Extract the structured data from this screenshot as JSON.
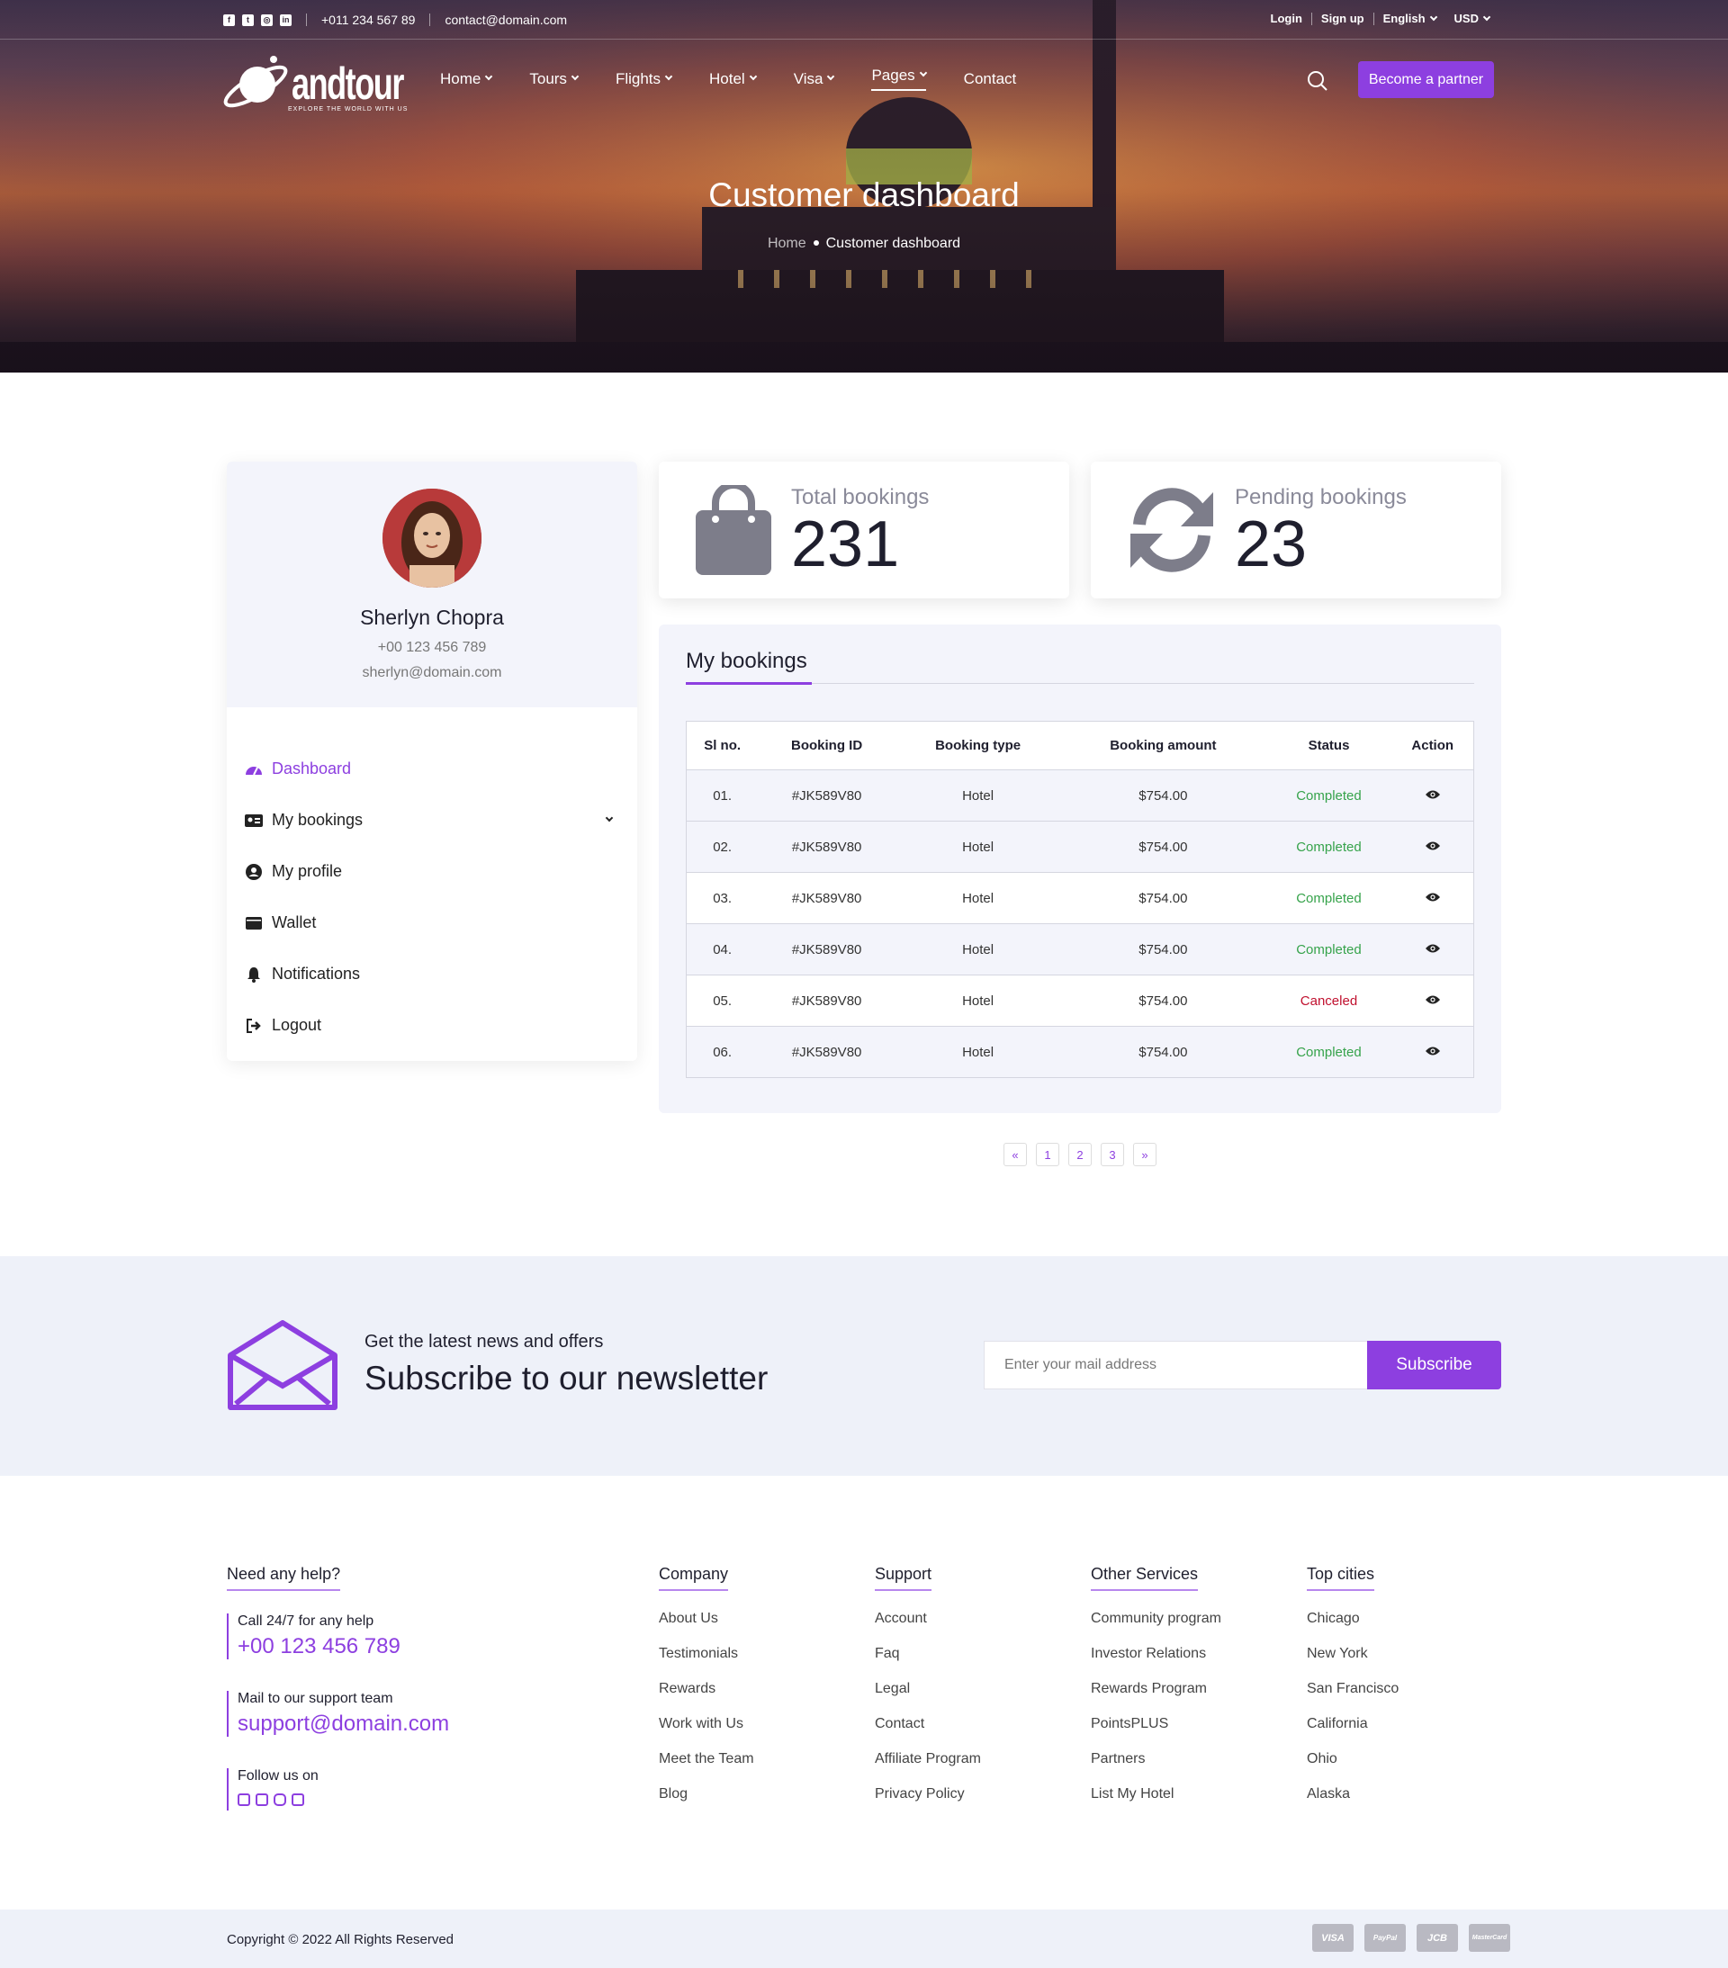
{
  "topbar": {
    "phone": "+011 234 567 89",
    "email": "contact@domain.com",
    "login": "Login",
    "signup": "Sign up",
    "language": "English",
    "currency": "USD",
    "social_icons": [
      "facebook-icon",
      "twitter-icon",
      "instagram-icon",
      "linkedin-icon"
    ]
  },
  "nav": {
    "logo_text": "andtour",
    "logo_tagline": "EXPLORE THE WORLD WITH US",
    "items": [
      {
        "label": "Home",
        "dropdown": true
      },
      {
        "label": "Tours",
        "dropdown": true
      },
      {
        "label": "Flights",
        "dropdown": true
      },
      {
        "label": "Hotel",
        "dropdown": true
      },
      {
        "label": "Visa",
        "dropdown": true
      },
      {
        "label": "Pages",
        "dropdown": true,
        "active": true
      },
      {
        "label": "Contact",
        "dropdown": false
      }
    ],
    "partner_button": "Become a partner"
  },
  "hero": {
    "title": "Customer dashboard",
    "breadcrumb_home": "Home",
    "breadcrumb_current": "Customer dashboard"
  },
  "profile": {
    "name": "Sherlyn Chopra",
    "phone": "+00 123 456 789",
    "email": "sherlyn@domain.com"
  },
  "sidebar": {
    "items": [
      {
        "label": "Dashboard",
        "icon": "dashboard-icon",
        "active": true
      },
      {
        "label": "My bookings",
        "icon": "id-card-icon"
      },
      {
        "label": "My profile",
        "icon": "user-circle-icon"
      },
      {
        "label": "Wallet",
        "icon": "wallet-icon"
      },
      {
        "label": "Notifications",
        "icon": "bell-icon"
      },
      {
        "label": "Logout",
        "icon": "logout-icon"
      }
    ]
  },
  "stats": {
    "total_label": "Total bookings",
    "total_value": "231",
    "pending_label": "Pending bookings",
    "pending_value": "23"
  },
  "bookings": {
    "title": "My bookings",
    "columns": [
      "Sl no.",
      "Booking ID",
      "Booking type",
      "Booking amount",
      "Status",
      "Action"
    ],
    "rows": [
      {
        "no": "01.",
        "id": "#JK589V80",
        "type": "Hotel",
        "amount": "$754.00",
        "status": "Completed"
      },
      {
        "no": "02.",
        "id": "#JK589V80",
        "type": "Hotel",
        "amount": "$754.00",
        "status": "Completed"
      },
      {
        "no": "03.",
        "id": "#JK589V80",
        "type": "Hotel",
        "amount": "$754.00",
        "status": "Completed"
      },
      {
        "no": "04.",
        "id": "#JK589V80",
        "type": "Hotel",
        "amount": "$754.00",
        "status": "Completed"
      },
      {
        "no": "05.",
        "id": "#JK589V80",
        "type": "Hotel",
        "amount": "$754.00",
        "status": "Canceled"
      },
      {
        "no": "06.",
        "id": "#JK589V80",
        "type": "Hotel",
        "amount": "$754.00",
        "status": "Completed"
      }
    ],
    "status_colors": {
      "Completed": "#36a34b",
      "Canceled": "#c0102e"
    }
  },
  "pagination": {
    "prev": "«",
    "pages": [
      "1",
      "2",
      "3"
    ],
    "next": "»"
  },
  "newsletter": {
    "small": "Get the latest news and offers",
    "big": "Subscribe to our newsletter",
    "placeholder": "Enter your mail address",
    "button": "Subscribe"
  },
  "footer": {
    "help": {
      "title": "Need any help?",
      "call_label": "Call 24/7 for any help",
      "call_value": "+00 123 456 789",
      "mail_label": "Mail to our support team",
      "mail_value": "support@domain.com",
      "follow_label": "Follow us on"
    },
    "columns": [
      {
        "title": "Company",
        "links": [
          "About Us",
          "Testimonials",
          "Rewards",
          "Work with Us",
          "Meet the Team",
          "Blog"
        ]
      },
      {
        "title": "Support",
        "links": [
          "Account",
          "Faq",
          "Legal",
          "Contact",
          "Affiliate Program",
          "Privacy Policy"
        ]
      },
      {
        "title": "Other Services",
        "links": [
          "Community program",
          "Investor Relations",
          "Rewards Program",
          "PointsPLUS",
          "Partners",
          "List My Hotel"
        ]
      },
      {
        "title": "Top cities",
        "links": [
          "Chicago",
          "New York",
          "San Francisco",
          "California",
          "Ohio",
          "Alaska"
        ]
      }
    ],
    "copyright": "Copyright © 2022 All Rights Reserved",
    "payment_cards": [
      "VISA",
      "PayPal",
      "JCB",
      "MasterCard"
    ]
  },
  "colors": {
    "accent": "#8d3fe0",
    "dark": "#1f1f2e",
    "soft_bg": "#eef1f9"
  }
}
